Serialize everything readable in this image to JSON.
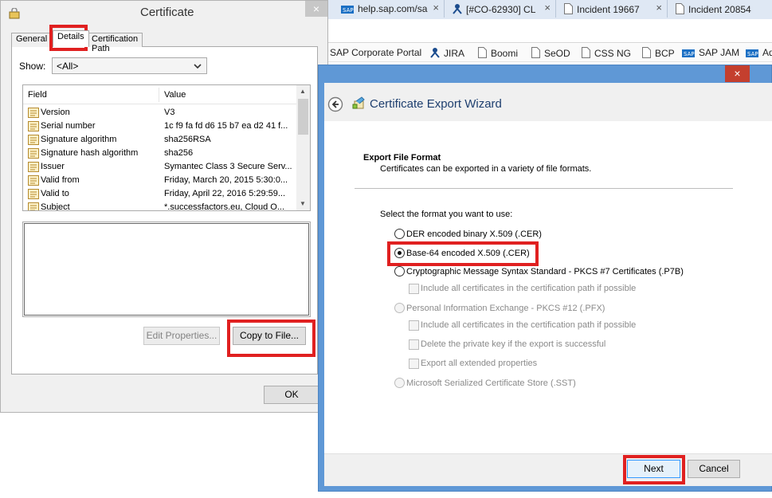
{
  "browser": {
    "tabs": [
      {
        "label": "help.sap.com/sa"
      },
      {
        "label": "[#CO-62930] CL"
      },
      {
        "label": "Incident 19667"
      },
      {
        "label": "Incident 20854"
      }
    ],
    "bookmarks": [
      {
        "label": "SAP Corporate Portal"
      },
      {
        "label": "JIRA"
      },
      {
        "label": "Boomi"
      },
      {
        "label": "SeOD"
      },
      {
        "label": "CSS NG"
      },
      {
        "label": "BCP"
      },
      {
        "label": "SAP JAM"
      },
      {
        "label": "Ad"
      }
    ],
    "tab_close": "×"
  },
  "certificate": {
    "title": "Certificate",
    "close_label": "×",
    "tabs": [
      "General",
      "Details",
      "Certification Path"
    ],
    "show_label": "Show:",
    "show_value": "<All>",
    "columns": {
      "field": "Field",
      "value": "Value"
    },
    "fields": [
      {
        "name": "Version",
        "value": "V3"
      },
      {
        "name": "Serial number",
        "value": "1c f9 fa fd d6 15 b7 ea d2 41 f..."
      },
      {
        "name": "Signature algorithm",
        "value": "sha256RSA"
      },
      {
        "name": "Signature hash algorithm",
        "value": "sha256"
      },
      {
        "name": "Issuer",
        "value": "Symantec Class 3 Secure Serv..."
      },
      {
        "name": "Valid from",
        "value": "Friday, March 20, 2015 5:30:0..."
      },
      {
        "name": "Valid to",
        "value": "Friday, April 22, 2016 5:29:59..."
      },
      {
        "name": "Subject",
        "value": "*.successfactors.eu, Cloud O..."
      }
    ],
    "edit_properties_label": "Edit Properties...",
    "copy_to_file_label": "Copy to File...",
    "ok_label": "OK"
  },
  "wizard": {
    "title": "Certificate Export Wizard",
    "close_label": "×",
    "section_title": "Export File Format",
    "section_desc": "Certificates can be exported in a variety of file formats.",
    "prompt": "Select the format you want to use:",
    "options": {
      "der": "DER encoded binary X.509 (.CER)",
      "base64": "Base-64 encoded X.509 (.CER)",
      "pkcs7": "Cryptographic Message Syntax Standard - PKCS #7 Certificates (.P7B)",
      "pkcs7_include": "Include all certificates in the certification path if possible",
      "pfx": "Personal Information Exchange - PKCS #12 (.PFX)",
      "pfx_include": "Include all certificates in the certification path if possible",
      "pfx_delete": "Delete the private key if the export is successful",
      "pfx_export_props": "Export all extended properties",
      "sst": "Microsoft Serialized Certificate Store (.SST)"
    },
    "selected_option": "base64",
    "next_label": "Next",
    "cancel_label": "Cancel"
  },
  "colors": {
    "highlight": "#e02020",
    "wizard_frame": "#5f98d6",
    "wizard_close": "#c43f2e"
  }
}
